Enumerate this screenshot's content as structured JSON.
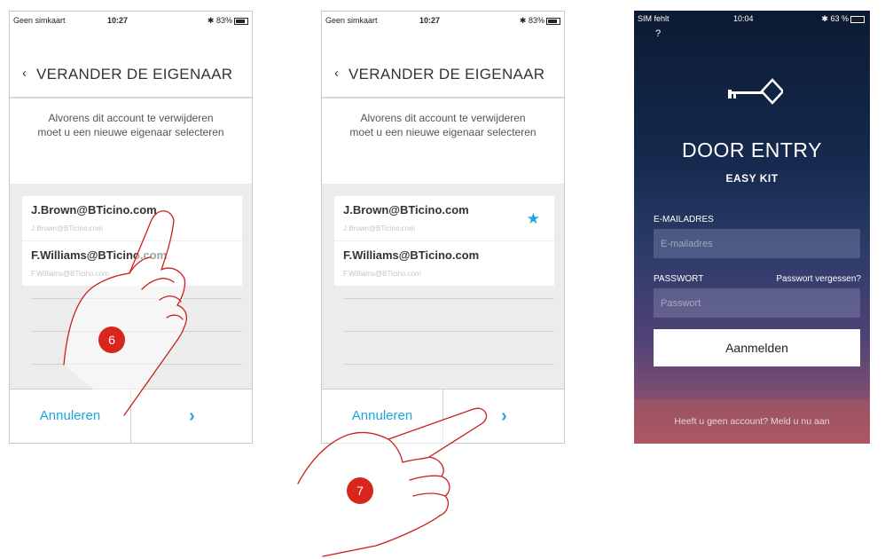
{
  "screen1": {
    "status": {
      "carrier": "Geen simkaart",
      "time": "10:27",
      "battery": "83%"
    },
    "header": {
      "back": "‹",
      "title": "VERANDER DE EIGENAAR"
    },
    "message": "Alvorens dit account te verwijderen moet u een nieuwe eigenaar selecteren",
    "users": [
      {
        "name": "J.Brown@BTicino.com",
        "email": "J.Brown@BTicino.com"
      },
      {
        "name": "F.Williams@BTicino.com",
        "email": "F.Williams@BTicino.com"
      }
    ],
    "cancel_label": "Annuleren",
    "next_label": "›",
    "step": "6"
  },
  "screen2": {
    "status": {
      "carrier": "Geen simkaart",
      "time": "10:27",
      "battery": "83%"
    },
    "header": {
      "back": "‹",
      "title": "VERANDER DE EIGENAAR"
    },
    "message": "Alvorens dit account te verwijderen moet u een nieuwe eigenaar selecteren",
    "users": [
      {
        "name": "J.Brown@BTicino.com",
        "email": "J.Brown@BTicino.com",
        "selected": true
      },
      {
        "name": "F.Williams@BTicino.com",
        "email": "F.Williams@BTicino.com"
      }
    ],
    "cancel_label": "Annuleren",
    "next_label": "›",
    "step": "7"
  },
  "screen3": {
    "status": {
      "carrier": "SIM fehlt",
      "time": "10:04",
      "battery": "63 %"
    },
    "help": "?",
    "app_title": "DOOR ENTRY",
    "app_subtitle": "EASY KIT",
    "email_label": "E-MAILADRES",
    "email_placeholder": "E-mailadres",
    "password_label": "PASSWORT",
    "forgot_link": "Passwort vergessen?",
    "password_placeholder": "Passwort",
    "login_button": "Aanmelden",
    "signup": "Heeft u geen account? Meld u nu aan"
  },
  "colors": {
    "accent": "#1ba6e1",
    "badge": "#d9261c",
    "hand_outline": "#c8201a"
  }
}
